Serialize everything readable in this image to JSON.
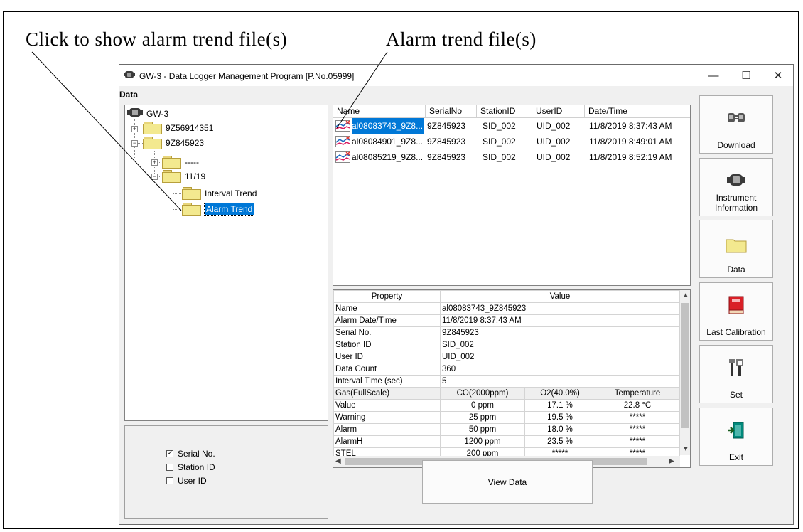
{
  "annotations": {
    "left": "Click to show alarm trend file(s)",
    "right": "Alarm trend file(s)"
  },
  "window": {
    "title": "GW-3 - Data Logger Management Program [P.No.05999]",
    "controls": {
      "minimize": "—",
      "maximize": "☐",
      "close": "✕"
    }
  },
  "data_group_label": "Data",
  "tree": {
    "root": "GW-3",
    "nodes": {
      "serial_a": "9Z56914351",
      "serial_b": "9Z845923",
      "placeholder": "-----",
      "month": "11/19",
      "interval": "Interval Trend",
      "alarm": "Alarm Trend"
    }
  },
  "filters": {
    "serial": "Serial No.",
    "station": "Station ID",
    "user": "User ID"
  },
  "file_list": {
    "columns": [
      "Name",
      "SerialNo",
      "StationID",
      "UserID",
      "Date/Time"
    ],
    "rows": [
      {
        "name": "al08083743_9Z8...",
        "serial": "9Z845923",
        "station": "SID_002",
        "user": "UID_002",
        "datetime": "11/8/2019 8:37:43 AM"
      },
      {
        "name": "al08084901_9Z8...",
        "serial": "9Z845923",
        "station": "SID_002",
        "user": "UID_002",
        "datetime": "11/8/2019 8:49:01 AM"
      },
      {
        "name": "al08085219_9Z8...",
        "serial": "9Z845923",
        "station": "SID_002",
        "user": "UID_002",
        "datetime": "11/8/2019 8:52:19 AM"
      }
    ]
  },
  "properties": {
    "header": {
      "property": "Property",
      "value": "Value"
    },
    "rows": [
      {
        "label": "Name",
        "value": "al08083743_9Z845923"
      },
      {
        "label": "Alarm Date/Time",
        "value": "11/8/2019 8:37:43 AM"
      },
      {
        "label": "Serial No.",
        "value": "9Z845923"
      },
      {
        "label": "Station ID",
        "value": "SID_002"
      },
      {
        "label": "User ID",
        "value": "UID_002"
      },
      {
        "label": "Data Count",
        "value": "360"
      },
      {
        "label": "Interval Time (sec)",
        "value": "5"
      }
    ],
    "gas_header": {
      "label": "Gas(FullScale)",
      "c1": "CO(2000ppm)",
      "c2": "O2(40.0%)",
      "c3": "Temperature"
    },
    "gas_rows": [
      {
        "label": "Value",
        "c1": "0 ppm",
        "c2": "17.1 %",
        "c3": "22.8 °C"
      },
      {
        "label": "Warning",
        "c1": "25 ppm",
        "c2": "19.5 %",
        "c3": "*****"
      },
      {
        "label": "Alarm",
        "c1": "50 ppm",
        "c2": "18.0 %",
        "c3": "*****"
      },
      {
        "label": "AlarmH",
        "c1": "1200 ppm",
        "c2": "23.5 %",
        "c3": "*****"
      },
      {
        "label": "STEL",
        "c1": "200 ppm",
        "c2": "*****",
        "c3": "*****"
      }
    ]
  },
  "view_button": "View Data",
  "side_buttons": {
    "download": "Download",
    "instrument_l1": "Instrument",
    "instrument_l2": "Information",
    "data": "Data",
    "calibration": "Last Calibration",
    "set": "Set",
    "exit": "Exit"
  },
  "colors": {
    "selection": "#0078d7",
    "folder": "#f3e98f",
    "calibration_book": "#d92027"
  }
}
